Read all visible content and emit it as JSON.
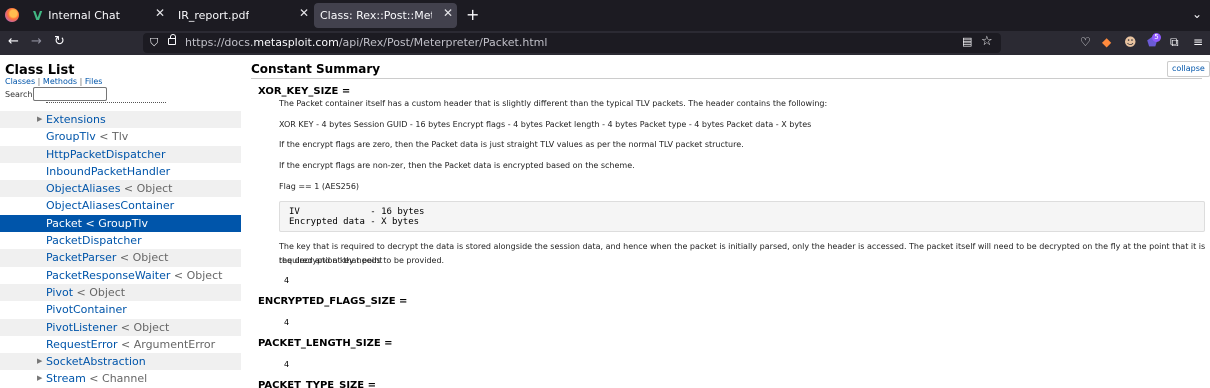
{
  "browser": {
    "tabs": [
      {
        "title": "Internal Chat",
        "icon": "vue-logo-icon",
        "active": false
      },
      {
        "title": "IR_report.pdf",
        "icon": "",
        "active": false
      },
      {
        "title": "Class: Rex::Post::Meterprete",
        "icon": "",
        "active": true
      }
    ],
    "url_prefix": "https://docs.",
    "url_domain": "metasploit.com",
    "url_path": "/api/Rex/Post/Meterpreter/Packet.html",
    "extension_badge": "5"
  },
  "sidebar": {
    "title": "Class List",
    "links": [
      "Classes",
      "Methods",
      "Files"
    ],
    "search_label": "Search:",
    "items": [
      {
        "name": "Extensions",
        "super": "",
        "toggle": "▶"
      },
      {
        "name": "GroupTlv",
        "super": " < Tlv",
        "toggle": ""
      },
      {
        "name": "HttpPacketDispatcher",
        "super": "",
        "toggle": ""
      },
      {
        "name": "InboundPacketHandler",
        "super": "",
        "toggle": ""
      },
      {
        "name": "ObjectAliases",
        "super": " < Object",
        "toggle": ""
      },
      {
        "name": "ObjectAliasesContainer",
        "super": "",
        "toggle": ""
      },
      {
        "name": "Packet",
        "super": " < GroupTlv",
        "toggle": "",
        "active": true
      },
      {
        "name": "PacketDispatcher",
        "super": "",
        "toggle": ""
      },
      {
        "name": "PacketParser",
        "super": " < Object",
        "toggle": ""
      },
      {
        "name": "PacketResponseWaiter",
        "super": " < Object",
        "toggle": ""
      },
      {
        "name": "Pivot",
        "super": " < Object",
        "toggle": ""
      },
      {
        "name": "PivotContainer",
        "super": "",
        "toggle": ""
      },
      {
        "name": "PivotListener",
        "super": " < Object",
        "toggle": ""
      },
      {
        "name": "RequestError",
        "super": " < ArgumentError",
        "toggle": ""
      },
      {
        "name": "SocketAbstraction",
        "super": "",
        "toggle": "▶"
      },
      {
        "name": "Stream",
        "super": " < Channel",
        "toggle": "▶"
      }
    ]
  },
  "main": {
    "section_title": "Constant Summary",
    "collapse_label": "collapse",
    "xor": {
      "name": "XOR_KEY_SIZE =",
      "p1": "The Packet container itself has a custom header that is slightly different than the typical TLV packets. The header contains the following:",
      "p2": "XOR KEY - 4 bytes Session GUID - 16 bytes Encrypt flags - 4 bytes Packet length - 4 bytes Packet type - 4 bytes Packet data - X bytes",
      "p3": "If the encrypt flags are zero, then the Packet data is just straight TLV values as per the normal TLV packet structure.",
      "p4": "If the encrypt flags are non-zer, then the Packet data is encrypted based on the scheme.",
      "p5": "Flag == 1 (AES256)",
      "code": "IV             - 16 bytes\nEncrypted data - X bytes",
      "p6a": "The key that is required to decrypt the data is stored alongside the session data, and hence when the packet is initially parsed, only the header is accessed. The packet itself will need to be decrypted on the fly at the point that it is required and at that point",
      "p6b": "the decryption key needs to be provided.",
      "value": "4"
    },
    "encrypted": {
      "name": "ENCRYPTED_FLAGS_SIZE =",
      "value": "4"
    },
    "length": {
      "name": "PACKET_LENGTH_SIZE =",
      "value": "4"
    },
    "type": {
      "name": "PACKET_TYPE_SIZE ="
    }
  }
}
